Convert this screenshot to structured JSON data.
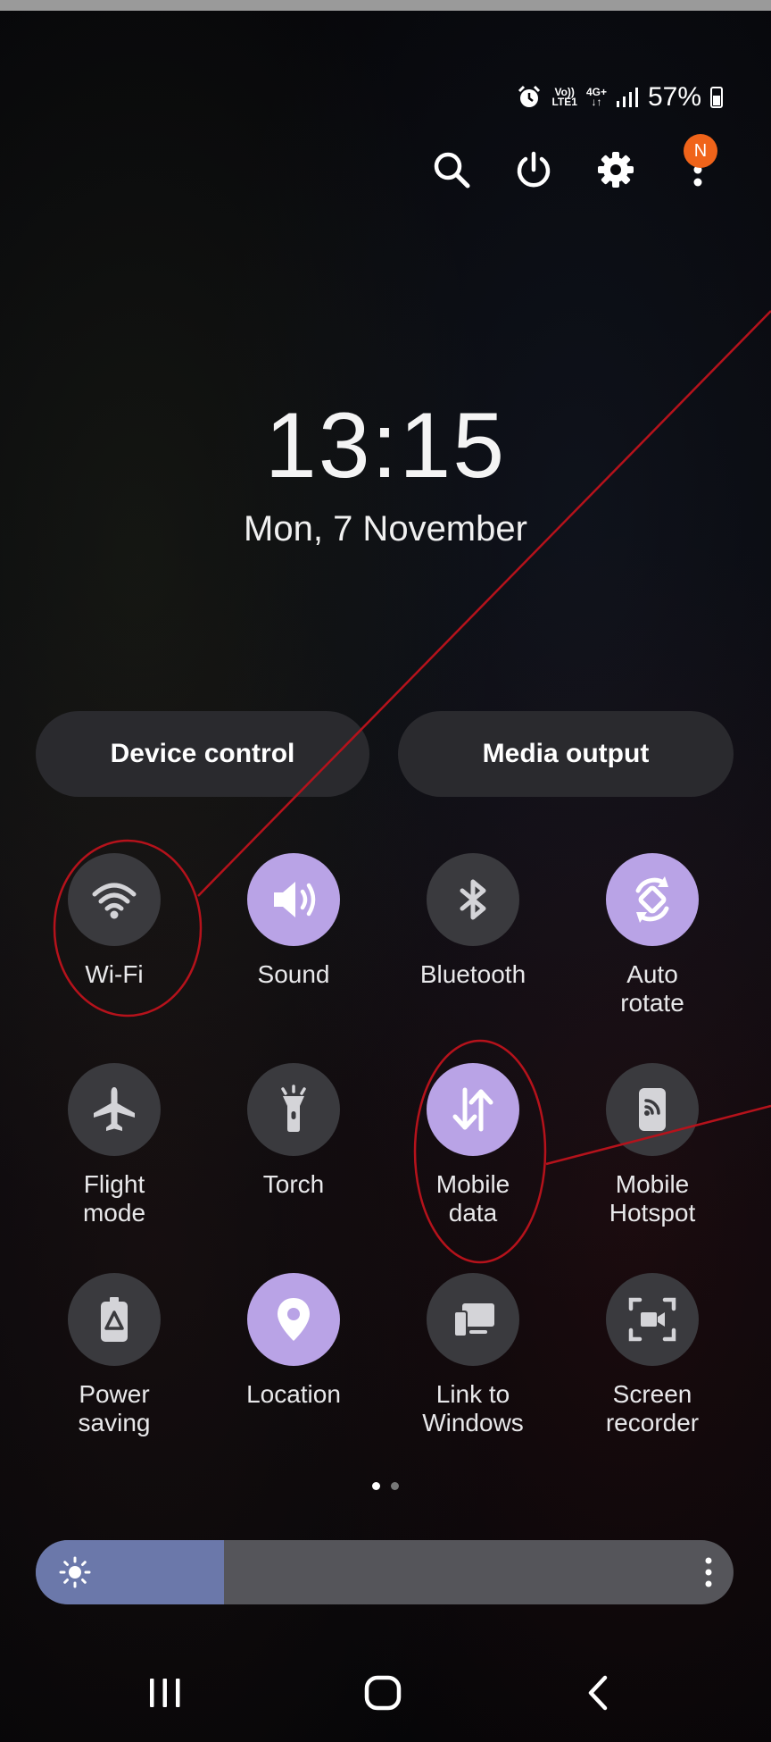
{
  "status_bar": {
    "volte_line1": "Vo))",
    "volte_line2": "LTE1",
    "network_type": "4G+",
    "battery_percent": "57%"
  },
  "header_icons": [
    "search-icon",
    "power-icon",
    "gear-icon",
    "more-icon"
  ],
  "notification_badge": "N",
  "clock": {
    "time": "13:15",
    "date": "Mon, 7 November"
  },
  "quick_buttons": {
    "device_control": "Device control",
    "media_output": "Media output"
  },
  "tiles": [
    {
      "label": "Wi-Fi",
      "active": false,
      "icon": "wifi-icon"
    },
    {
      "label": "Sound",
      "active": true,
      "icon": "sound-icon"
    },
    {
      "label": "Bluetooth",
      "active": false,
      "icon": "bluetooth-icon"
    },
    {
      "label": "Auto\nrotate",
      "active": true,
      "icon": "auto-rotate-icon"
    },
    {
      "label": "Flight\nmode",
      "active": false,
      "icon": "airplane-icon"
    },
    {
      "label": "Torch",
      "active": false,
      "icon": "torch-icon"
    },
    {
      "label": "Mobile\ndata",
      "active": true,
      "icon": "mobile-data-icon"
    },
    {
      "label": "Mobile\nHotspot",
      "active": false,
      "icon": "hotspot-icon"
    },
    {
      "label": "Power\nsaving",
      "active": false,
      "icon": "power-saving-icon"
    },
    {
      "label": "Location",
      "active": true,
      "icon": "location-icon"
    },
    {
      "label": "Link to\nWindows",
      "active": false,
      "icon": "link-to-windows-icon"
    },
    {
      "label": "Screen\nrecorder",
      "active": false,
      "icon": "screen-recorder-icon"
    }
  ],
  "pages": {
    "count": 2,
    "current": 1
  },
  "brightness": {
    "level": 0.27
  },
  "colors": {
    "active_tile": "#b9a3e6",
    "inactive_tile": "#3a3a3e",
    "annotation": "#b5121b",
    "badge": "#f0641a",
    "brightness_fill": "#6b78aa"
  }
}
